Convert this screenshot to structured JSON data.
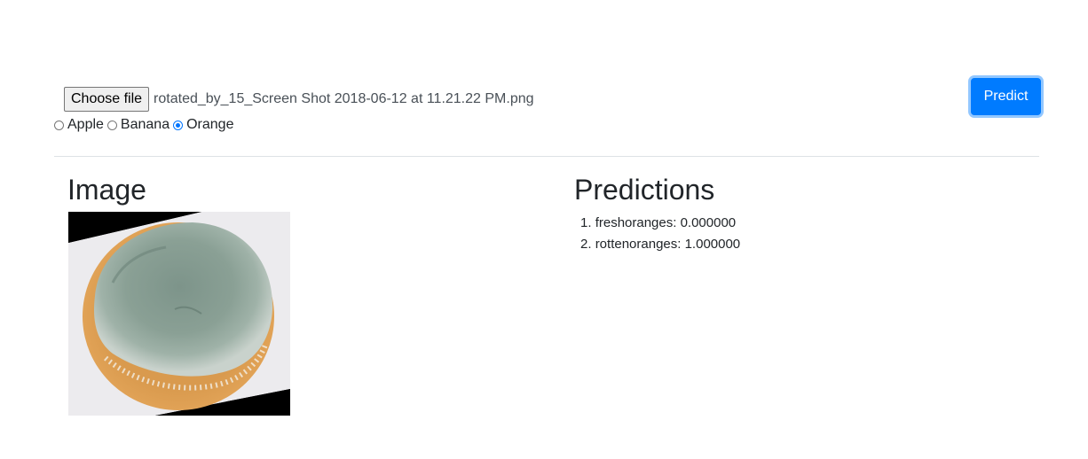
{
  "upload": {
    "choose_label": "Choose file",
    "file_name": "rotated_by_15_Screen Shot 2018-06-12 at 11.21.22 PM.png"
  },
  "fruit_options": [
    {
      "label": "Apple",
      "checked": false
    },
    {
      "label": "Banana",
      "checked": false
    },
    {
      "label": "Orange",
      "checked": true
    }
  ],
  "predict_label": "Predict",
  "image_section": {
    "title": "Image"
  },
  "predictions_section": {
    "title": "Predictions",
    "items": [
      {
        "number": "1.",
        "text": "freshoranges: 0.000000"
      },
      {
        "number": "2.",
        "text": "rottenoranges: 1.000000"
      }
    ]
  },
  "colors": {
    "primary": "#007bff",
    "text": "#212529",
    "divider": "#dee2e6"
  }
}
